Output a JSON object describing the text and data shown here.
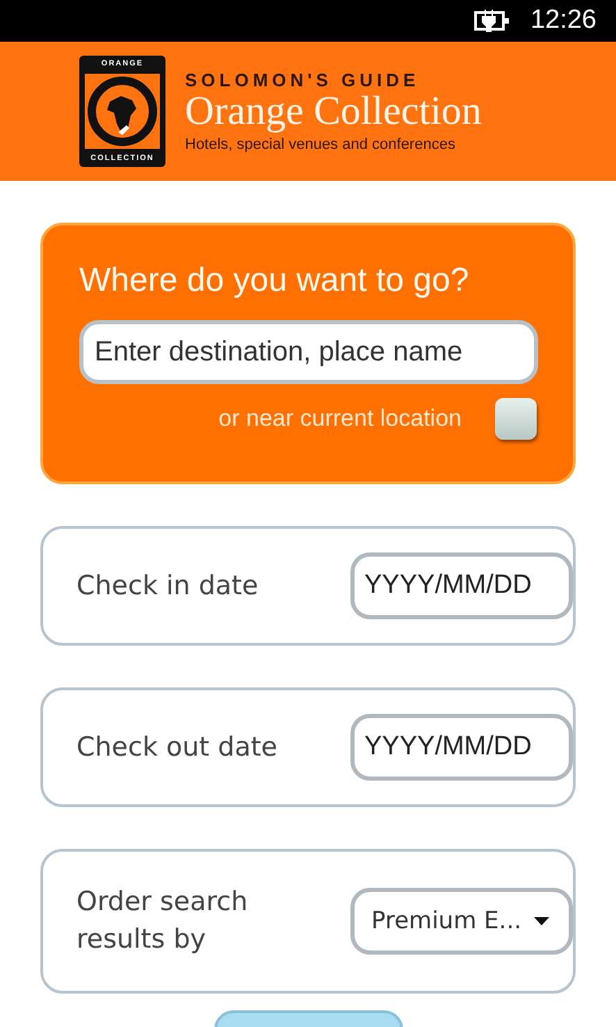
{
  "status_bar": {
    "time": "12:26"
  },
  "header": {
    "logo_top": "ORANGE",
    "logo_bottom": "COLLECTION",
    "overline": "SOLOMON'S GUIDE",
    "title": "Orange Collection",
    "tagline": "Hotels, special venues and conferences"
  },
  "destination": {
    "heading": "Where do you want to go?",
    "placeholder": "Enter destination, place name",
    "near_label": "or near current location",
    "near_checked": false
  },
  "fields": [
    {
      "label": "Check in date",
      "kind": "date",
      "placeholder": "YYYY/MM/DD"
    },
    {
      "label": "Check out date",
      "kind": "date",
      "placeholder": "YYYY/MM/DD"
    },
    {
      "label": "Order search results by",
      "kind": "select",
      "value": "Premium E..."
    }
  ]
}
